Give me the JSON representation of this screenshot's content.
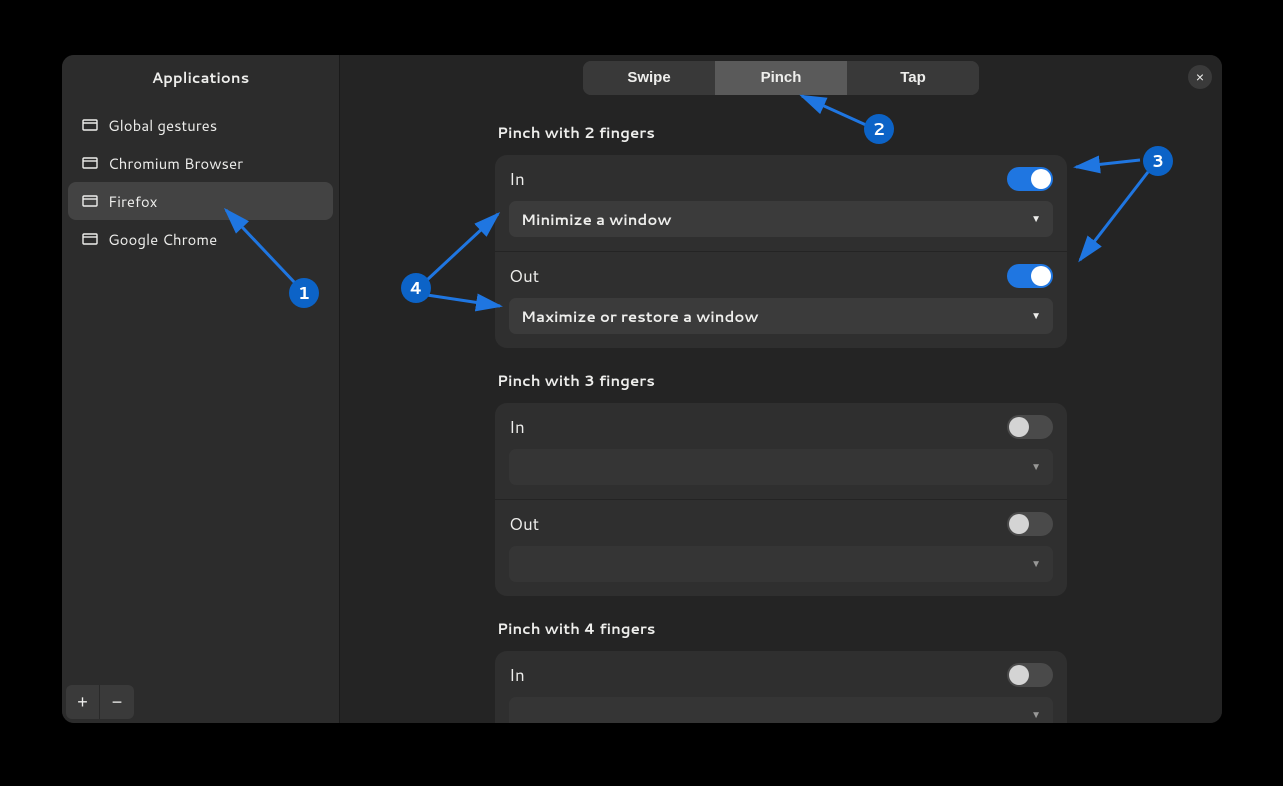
{
  "sidebar": {
    "title": "Applications",
    "items": [
      {
        "label": "Global gestures",
        "selected": false
      },
      {
        "label": "Chromium Browser",
        "selected": false
      },
      {
        "label": "Firefox",
        "selected": true
      },
      {
        "label": "Google Chrome",
        "selected": false
      }
    ],
    "add_label": "+",
    "remove_label": "−"
  },
  "header": {
    "tabs": [
      {
        "label": "Swipe",
        "active": false
      },
      {
        "label": "Pinch",
        "active": true
      },
      {
        "label": "Tap",
        "active": false
      }
    ],
    "close_label": "×"
  },
  "sections": [
    {
      "title": "Pinch with 2 fingers",
      "rows": [
        {
          "name": "In",
          "enabled": true,
          "action": "Minimize a window"
        },
        {
          "name": "Out",
          "enabled": true,
          "action": "Maximize or restore a window"
        }
      ]
    },
    {
      "title": "Pinch with 3 fingers",
      "rows": [
        {
          "name": "In",
          "enabled": false,
          "action": ""
        },
        {
          "name": "Out",
          "enabled": false,
          "action": ""
        }
      ]
    },
    {
      "title": "Pinch with 4 fingers",
      "rows": [
        {
          "name": "In",
          "enabled": false,
          "action": ""
        }
      ]
    }
  ],
  "annotations": {
    "1": "1",
    "2": "2",
    "3": "3",
    "4": "4"
  }
}
